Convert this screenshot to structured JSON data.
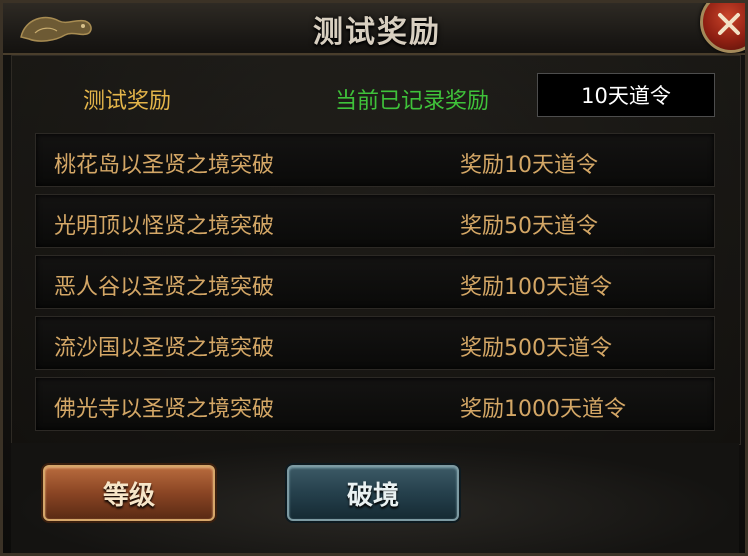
{
  "window": {
    "title": "测试奖励",
    "close_icon": "close-icon"
  },
  "header": {
    "subtitle": "测试奖励",
    "current_label": "当前已记录奖励",
    "current_value": "10天道令"
  },
  "rewards": [
    {
      "name": "桃花岛以圣贤之境突破",
      "reward": "奖励10天道令"
    },
    {
      "name": "光明顶以怪贤之境突破",
      "reward": "奖励50天道令"
    },
    {
      "name": "恶人谷以圣贤之境突破",
      "reward": "奖励100天道令"
    },
    {
      "name": "流沙国以圣贤之境突破",
      "reward": "奖励500天道令"
    },
    {
      "name": "佛光寺以圣贤之境突破",
      "reward": "奖励1000天道令"
    }
  ],
  "buttons": {
    "level": "等级",
    "breakthrough": "破境"
  },
  "colors": {
    "gold_text": "#e4b54a",
    "green_text": "#3fc23a",
    "row_text": "#d4a766"
  }
}
